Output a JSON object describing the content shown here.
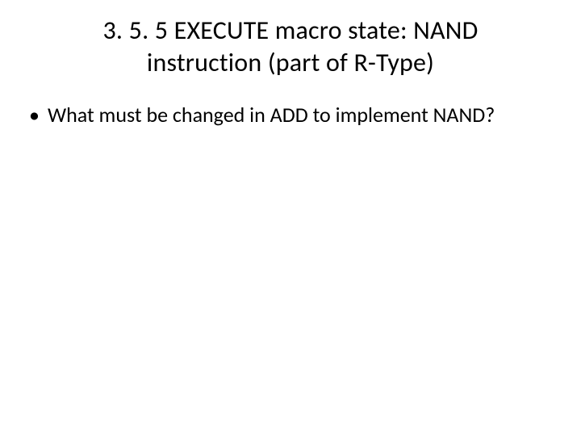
{
  "slide": {
    "title": "3. 5. 5 EXECUTE macro state: NAND instruction (part of R-Type)",
    "bullets": [
      {
        "marker": "•",
        "text": "What must be changed in ADD to implement NAND?"
      }
    ]
  }
}
